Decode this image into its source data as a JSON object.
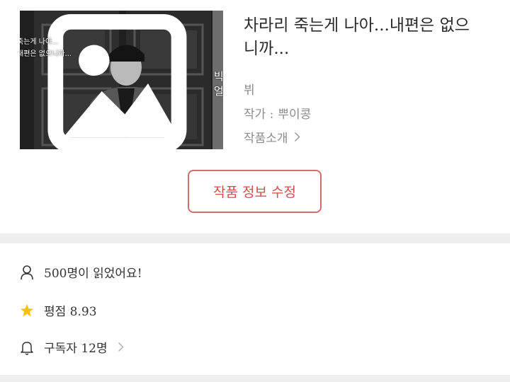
{
  "cover": {
    "badge_label": "빅주얼",
    "caption_lines": "죽는게 나아...\n내편은 없으니까..."
  },
  "work": {
    "title": "차라리 죽는게 나아...내편은 없으니까...",
    "genre": "뷔",
    "author_label": "작가 :",
    "author_name": "뿌이콩",
    "intro_label": "작품소개"
  },
  "actions": {
    "edit_label": "작품 정보 수정"
  },
  "stats": {
    "readers": "500명이 읽었어요!",
    "rating": "평점 8.93",
    "subscribers": "구독자 12명"
  },
  "colors": {
    "accent": "#d04e4e",
    "star": "#f4c20d",
    "muted_text": "#8c8c8c",
    "divider": "#eeeeee"
  }
}
